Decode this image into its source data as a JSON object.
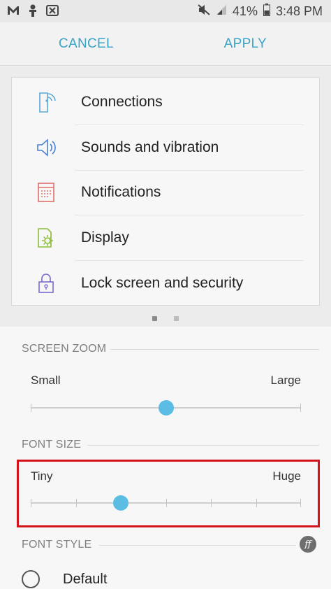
{
  "status_bar": {
    "battery_percent": "41%",
    "time": "3:48 PM",
    "left_icons": [
      "gmail-icon",
      "person-icon",
      "box-app-icon"
    ],
    "right_icons": [
      "mute-icon",
      "signal-icon",
      "battery-icon"
    ]
  },
  "action_bar": {
    "cancel_label": "CANCEL",
    "apply_label": "APPLY",
    "accent_color": "#3aa3c6"
  },
  "preview": {
    "items": [
      {
        "label": "Connections",
        "icon": "connections-icon",
        "color": "#5aa7d8"
      },
      {
        "label": "Sounds and vibration",
        "icon": "speaker-icon",
        "color": "#4a7fd0"
      },
      {
        "label": "Notifications",
        "icon": "notifications-icon",
        "color": "#e0706a"
      },
      {
        "label": "Display",
        "icon": "display-brightness-icon",
        "color": "#8bbd3a"
      },
      {
        "label": "Lock screen and security",
        "icon": "lock-icon",
        "color": "#7a6bd0"
      }
    ],
    "page_count": 2,
    "active_page": 1
  },
  "screen_zoom": {
    "title": "SCREEN ZOOM",
    "min_label": "Small",
    "max_label": "Large",
    "value_fraction": 0.5,
    "thumb_color": "#5bbde4"
  },
  "font_size": {
    "title": "FONT SIZE",
    "min_label": "Tiny",
    "max_label": "Huge",
    "steps": 7,
    "selected_step": 2,
    "highlight_color": "#d4141c"
  },
  "font_style": {
    "title": "FONT STYLE",
    "option_label": "Default",
    "icon": "font-style-icon"
  }
}
